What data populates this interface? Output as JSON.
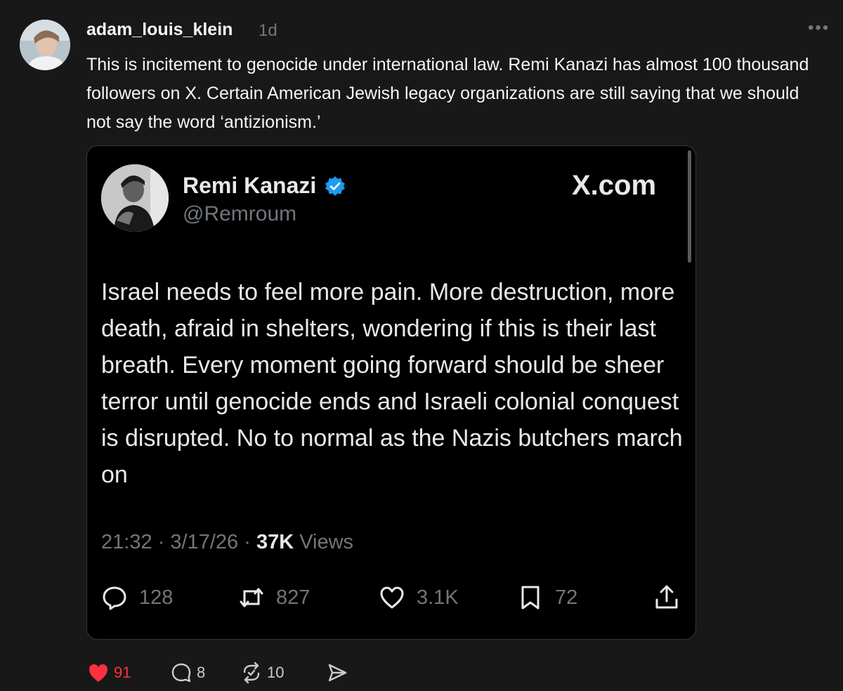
{
  "post": {
    "username": "adam_louis_klein",
    "time": "1d",
    "more_label": "•••",
    "text": "This is incitement to genocide under international law. Remi Kanazi has almost 100 thousand followers on X. Certain American Jewish legacy organizations are still saying that we should not say the word ‘antizionism.’"
  },
  "embed": {
    "name": "Remi Kanazi",
    "handle": "@Remroum",
    "brand": "X.com",
    "text": "Israel needs to feel more pain. More destruction, more death, afraid in shelters, wondering if this is their last breath. Every moment going forward should be sheer terror until genocide ends and Israeli colonial conquest is disrupted. No to normal as the Nazis butchers march on",
    "time": "21:32",
    "date": "3/17/26",
    "views_count": "37K",
    "views_label": "Views",
    "sep": "·",
    "replies": "128",
    "reposts": "827",
    "likes": "3.1K",
    "bookmarks": "72"
  },
  "bottom_actions": {
    "likes": "91",
    "comments": "8",
    "reposts": "10"
  },
  "colors": {
    "background": "#181818",
    "embed_background": "#000000",
    "like_active": "#ff3040",
    "verified": "#1d9bf0",
    "muted": "#71767b"
  }
}
